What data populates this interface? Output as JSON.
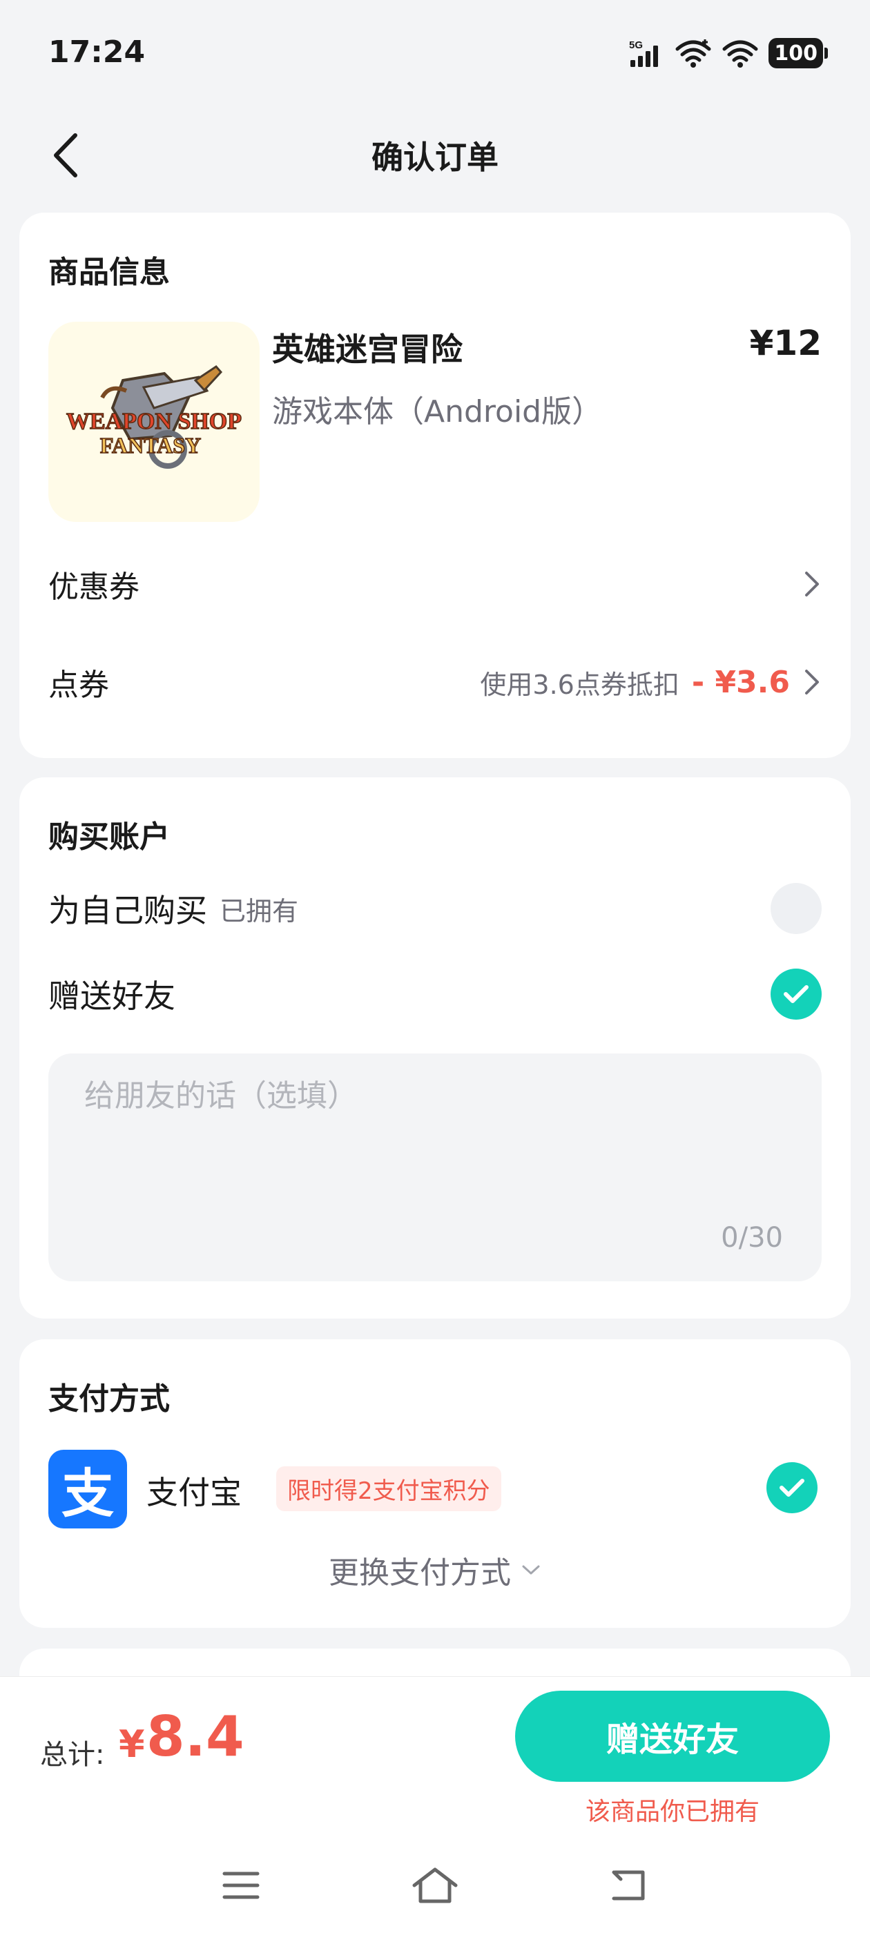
{
  "status_bar": {
    "time": "17:24",
    "network": "5G",
    "battery": "100"
  },
  "header": {
    "title": "确认订单"
  },
  "product": {
    "section_title": "商品信息",
    "name": "英雄迷宫冒险",
    "price": "¥12",
    "variant": "游戏本体（Android版）",
    "thumb_logo_line1": "WEAPON SHOP",
    "thumb_logo_line2": "FANTASY",
    "coupon_label": "优惠券",
    "points_label": "点券",
    "points_hint": "使用3.6点券抵扣",
    "points_discount": "- ¥3.6"
  },
  "account": {
    "section_title": "购买账户",
    "self_label": "为自己购买",
    "self_tag": "已拥有",
    "self_selected": false,
    "gift_label": "赠送好友",
    "gift_selected": true,
    "message_placeholder": "给朋友的话（选填）",
    "message_value": "",
    "message_count": "0/30"
  },
  "payment": {
    "section_title": "支付方式",
    "method_name": "支付宝",
    "method_logo_char": "支",
    "promo": "限时得2支付宝积分",
    "method_selected": true,
    "change_label": "更换支付方式"
  },
  "footer": {
    "total_label": "总计:",
    "currency": "¥",
    "total_value": "8.4",
    "action_label": "赠送好友",
    "owned_note": "该商品你已拥有"
  },
  "colors": {
    "accent": "#13d2b9",
    "price_red": "#f05b4d",
    "alipay_blue": "#1677ff",
    "background": "#f3f4f6"
  }
}
